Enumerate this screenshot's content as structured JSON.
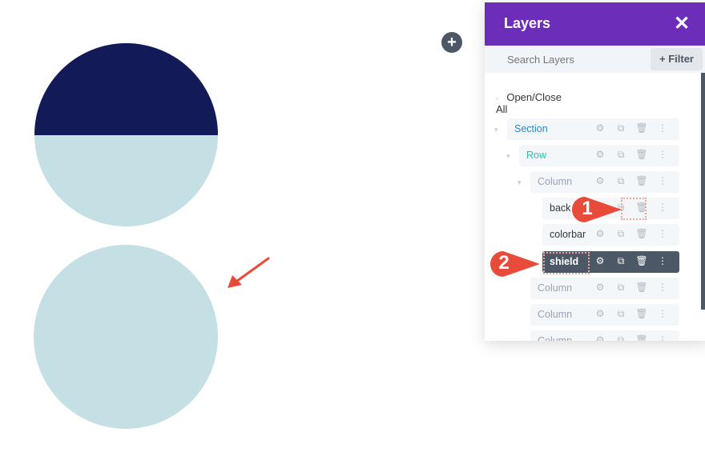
{
  "canvas": {
    "circle_top": {
      "top_color": "#121a58",
      "bottom_color": "#c4e0e5"
    },
    "circle_bottom": {
      "color": "#c4e0e5"
    },
    "add_button_label": "+",
    "arrow_color": "#e84b3a"
  },
  "layers_panel": {
    "title": "Layers",
    "close_label": "✕",
    "search_placeholder": "Search Layers",
    "filter_label": "+ Filter",
    "open_close_all": "Open/Close All",
    "items": [
      {
        "label": "Section",
        "color": "#2e85c4"
      },
      {
        "label": "Row",
        "color": "#29c4a9"
      },
      {
        "label": "Column",
        "color": "#9aa4b1"
      },
      {
        "label": "back",
        "color": "#32373c"
      },
      {
        "label": "colorbar",
        "color": "#32373c"
      },
      {
        "label": "shield",
        "color": "#ffffff",
        "selected": true
      },
      {
        "label": "Column",
        "color": "#9aa4b1"
      },
      {
        "label": "Column",
        "color": "#9aa4b1"
      },
      {
        "label": "Column",
        "color": "#9aa4b1"
      }
    ],
    "icons": {
      "settings": "⚙",
      "duplicate": "⧉",
      "delete": "🗑",
      "more": "⋮"
    }
  },
  "annotations": {
    "step1": "1",
    "step2": "2"
  }
}
